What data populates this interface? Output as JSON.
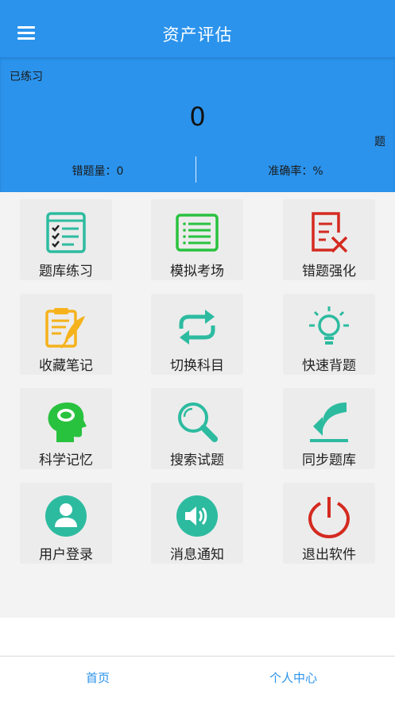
{
  "header": {
    "title": "资产评估",
    "menu_icon": "hamburger-menu-icon"
  },
  "stats": {
    "practiced_label": "已练习",
    "practiced_count": "0",
    "practiced_unit": "题",
    "wrong_count_text": "错题量：0",
    "accuracy_text": "准确率：%"
  },
  "menu": [
    {
      "label": "题库练习",
      "icon": "checklist-icon"
    },
    {
      "label": "模拟考场",
      "icon": "exam-sheet-icon"
    },
    {
      "label": "错题强化",
      "icon": "wrong-doc-icon"
    },
    {
      "label": "收藏笔记",
      "icon": "clipboard-quill-icon"
    },
    {
      "label": "切换科目",
      "icon": "switch-arrows-icon"
    },
    {
      "label": "快速背题",
      "icon": "lightbulb-icon"
    },
    {
      "label": "科学记忆",
      "icon": "brain-head-icon"
    },
    {
      "label": "搜索试题",
      "icon": "magnifier-icon"
    },
    {
      "label": "同步题库",
      "icon": "download-arrow-icon"
    },
    {
      "label": "用户登录",
      "icon": "user-avatar-icon"
    },
    {
      "label": "消息通知",
      "icon": "speaker-icon"
    },
    {
      "label": "退出软件",
      "icon": "power-icon"
    }
  ],
  "tabs": {
    "home": "首页",
    "profile": "个人中心"
  },
  "colors": {
    "primary": "#2b93ec",
    "green": "#29c23f",
    "teal": "#2dbba0",
    "red": "#d42a20",
    "orange": "#f5b21a"
  }
}
